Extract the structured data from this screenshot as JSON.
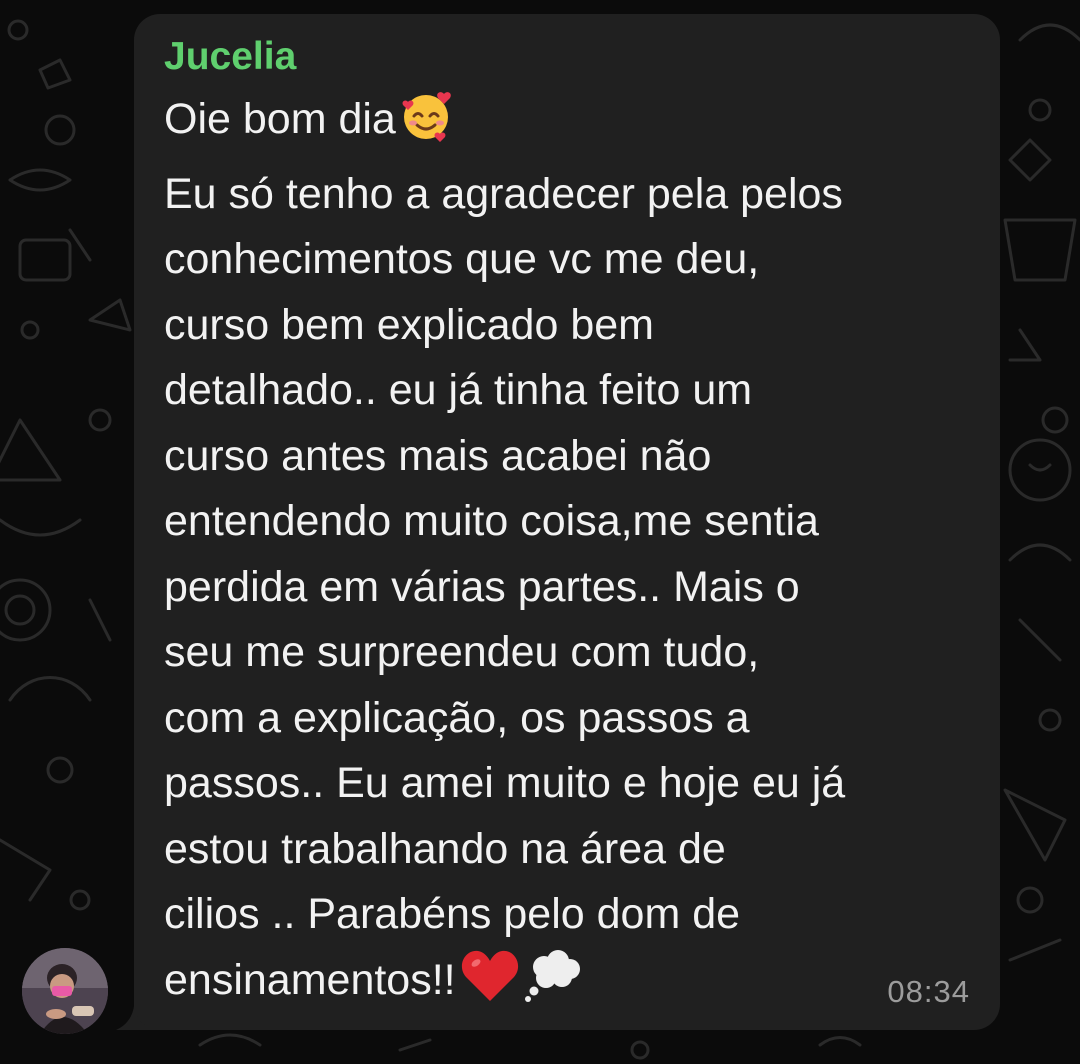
{
  "chat": {
    "message": {
      "sender_name": "Jucelia",
      "lines": [
        "Oie bom dia",
        "Eu só tenho a agradecer pela pelos",
        "conhecimentos que vc me deu,",
        "curso bem explicado bem",
        "detalhado.. eu já tinha feito um",
        "curso antes mais acabei não",
        "entendendo muito coisa,me sentia",
        "perdida em várias partes..  Mais o",
        "seu me surpreendeu com tudo,",
        "com a explicação, os passos a",
        "passos.. Eu amei muito e hoje eu já",
        "estou trabalhando na área de",
        "cilios .. Parabéns pelo dom de",
        "ensinamentos!!"
      ],
      "emoji_first_line": "smiling-face-with-hearts-icon",
      "emoji_last_line": [
        "red-heart-icon",
        "thought-balloon-icon"
      ],
      "time": "08:34"
    },
    "colors": {
      "background": "#0b0b0b",
      "bubble": "#202020",
      "sender_name": "#5fcf6e",
      "message_text": "#f2f2f2",
      "timestamp": "#9c9c9c"
    }
  }
}
